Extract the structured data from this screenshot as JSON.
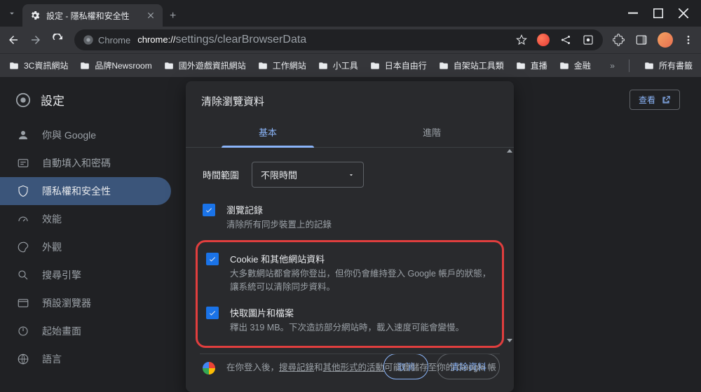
{
  "window": {
    "tab_title": "設定 - 隱私權和安全性"
  },
  "address": {
    "protocol_label": "Chrome",
    "host": "chrome://",
    "path": "settings/clearBrowserData"
  },
  "bookmarks": [
    "3C資訊網站",
    "品牌Newsroom",
    "國外遊戲資訊網站",
    "工作網站",
    "小工具",
    "日本自由行",
    "自架站工具類",
    "直播",
    "金融"
  ],
  "bookmarks_overflow": "所有書籤",
  "sidebar": {
    "title": "設定",
    "items": [
      {
        "label": "你與 Google",
        "selected": false
      },
      {
        "label": "自動填入和密碼",
        "selected": false
      },
      {
        "label": "隱私權和安全性",
        "selected": true
      },
      {
        "label": "效能",
        "selected": false
      },
      {
        "label": "外觀",
        "selected": false
      },
      {
        "label": "搜尋引擎",
        "selected": false
      },
      {
        "label": "預設瀏覽器",
        "selected": false
      },
      {
        "label": "起始畫面",
        "selected": false
      },
      {
        "label": "語言",
        "selected": false
      }
    ]
  },
  "main": {
    "corner_button": "查看"
  },
  "modal": {
    "title": "清除瀏覽資料",
    "tabs": {
      "basic": "基本",
      "advanced": "進階"
    },
    "time": {
      "label": "時間範圍",
      "value": "不限時間"
    },
    "items": [
      {
        "title": "瀏覽記錄",
        "desc": "清除所有同步裝置上的記錄"
      },
      {
        "title": "Cookie 和其他網站資料",
        "desc": "大多數網站都會將你登出，但你仍會維持登入 Google 帳戶的狀態，讓系統可以清除同步資料。"
      },
      {
        "title": "快取圖片和檔案",
        "desc": "釋出 319 MB。下次造訪部分網站時，載入速度可能會變慢。"
      }
    ],
    "footnote_before": "在你登入後，",
    "footnote_link1": "搜尋記錄",
    "footnote_mid": "和",
    "footnote_link2": "其他形式的活動",
    "footnote_after": "可能會儲存至你的 Google 帳",
    "actions": {
      "cancel": "取消",
      "confirm": "清除資料"
    }
  }
}
